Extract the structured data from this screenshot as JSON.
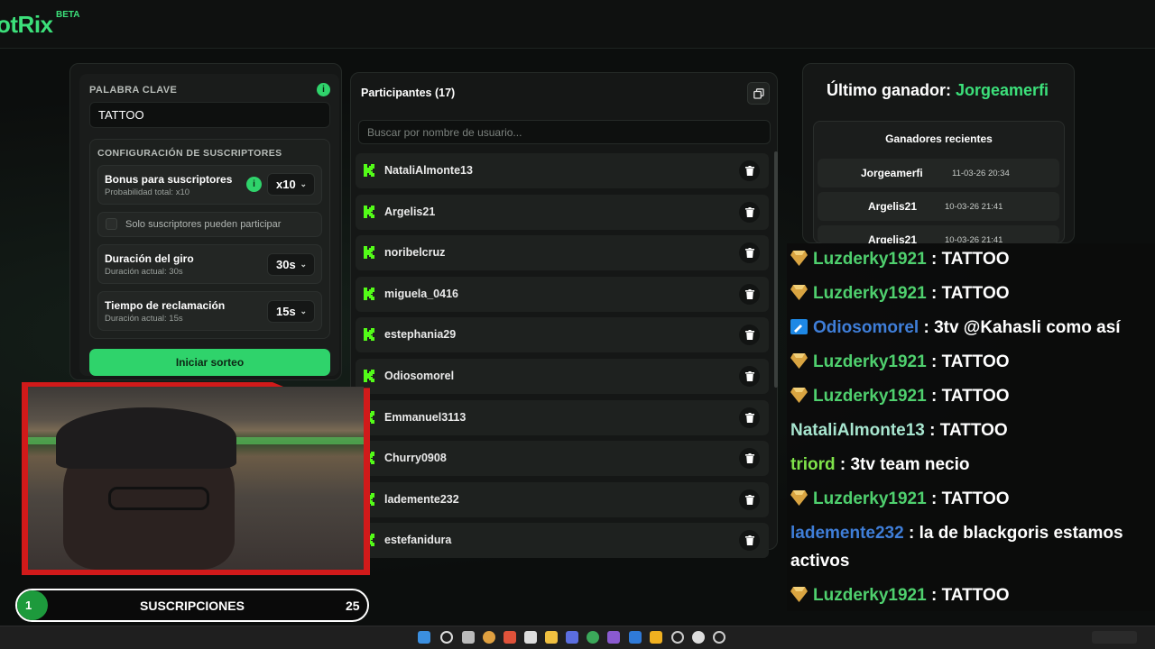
{
  "app": {
    "logo_text": "otRix",
    "logo_badge": "BETA"
  },
  "keyword": {
    "label": "PALABRA CLAVE",
    "value": "TATTOO"
  },
  "subscribers_config": {
    "title": "CONFIGURACIÓN DE SUSCRIPTORES",
    "bonus": {
      "title": "Bonus para suscriptores",
      "subtitle": "Probabilidad total: x10",
      "value": "x10"
    },
    "only_subs_label": "Solo suscriptores pueden participar",
    "spin_duration": {
      "title": "Duración del giro",
      "subtitle": "Duración actual: 30s",
      "value": "30s"
    },
    "claim_time": {
      "title": "Tiempo de reclamación",
      "subtitle": "Duración actual: 15s",
      "value": "15s"
    }
  },
  "start_button_label": "Iniciar sorteo",
  "participants": {
    "title": "Participantes (17)",
    "search_placeholder": "Buscar por nombre de usuario...",
    "items": [
      "NataliAlmonte13",
      "Argelis21",
      "noribelcruz",
      "miguela_0416",
      "estephania29",
      "Odiosomorel",
      "Emmanuel3113",
      "Churry0908",
      "lademente232",
      "estefanidura"
    ]
  },
  "winners": {
    "last_label": "Último ganador:",
    "last_name": "Jorgeamerfi",
    "recent_title": "Ganadores recientes",
    "recent": [
      {
        "name": "Jorgeamerfi",
        "date": "11-03-26 20:34"
      },
      {
        "name": "Argelis21",
        "date": "10-03-26 21:41"
      },
      {
        "name": "Argelis21",
        "date": "10-03-26 21:41"
      }
    ]
  },
  "chat": [
    {
      "user": "Luzderky1921",
      "text": " : TATTOO"
    },
    {
      "user": "Luzderky1921",
      "text": " : TATTOO"
    },
    {
      "user": "Odiosomorel",
      "text": " : 3tv @Kahasli como así"
    },
    {
      "user": "Luzderky1921",
      "text": " : TATTOO"
    },
    {
      "user": "Luzderky1921",
      "text": " : TATTOO"
    },
    {
      "user": "NataliAlmonte13",
      "text": " : TATTOO"
    },
    {
      "user": "triord",
      "text": " : 3tv team necio"
    },
    {
      "user": "Luzderky1921",
      "text": " : TATTOO"
    },
    {
      "user": "lademente232",
      "text": " : la de blackgoris estamos"
    },
    {
      "user": "",
      "text": "activos"
    },
    {
      "user": "Luzderky1921",
      "text": " : TATTOO"
    }
  ],
  "subs_bar": {
    "current": "1",
    "label": "SUSCRIPCIONES",
    "goal": "25"
  },
  "colors": {
    "accent": "#2fd36b",
    "frame": "#d11a1a"
  }
}
